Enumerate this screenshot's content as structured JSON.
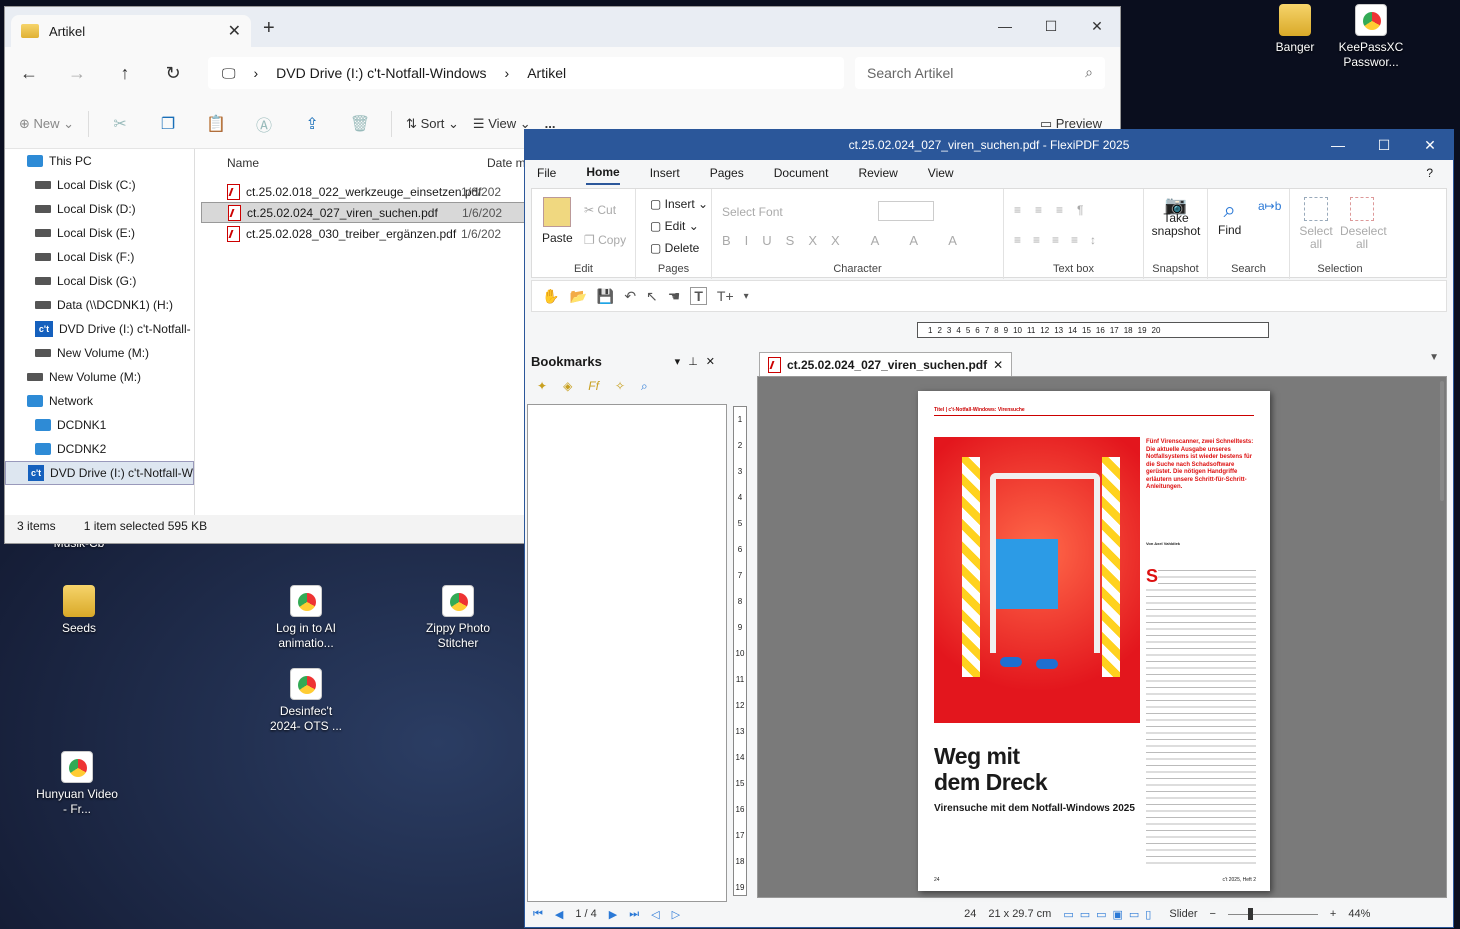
{
  "desktop": {
    "icons": [
      {
        "label": "Banger",
        "type": "folder"
      },
      {
        "label": "KeePassXC Passwor...",
        "type": "chrome"
      },
      {
        "label": "Seeds",
        "type": "folder"
      },
      {
        "label": "Log in to AI animatio...",
        "type": "chrome"
      },
      {
        "label": "Zippy Photo Stitcher",
        "type": "chrome"
      },
      {
        "label": "Desinfec't 2024- OTS ...",
        "type": "chrome"
      },
      {
        "label": "Hunyuan Video - Fr...",
        "type": "chrome"
      },
      {
        "label": "Musik-Cb",
        "type": "text"
      }
    ]
  },
  "explorer": {
    "tab_title": "Artikel",
    "breadcrumb": [
      "DVD Drive (I:) c't-Notfall-Windows",
      "Artikel"
    ],
    "search_placeholder": "Search Artikel",
    "commands": {
      "new": "New",
      "sort": "Sort",
      "view": "View",
      "more": "...",
      "preview": "Preview"
    },
    "nav_items": [
      {
        "label": "This PC",
        "kind": "pc"
      },
      {
        "label": "Local Disk (C:)",
        "kind": "drive"
      },
      {
        "label": "Local Disk (D:)",
        "kind": "drive"
      },
      {
        "label": "Local Disk (E:)",
        "kind": "drive"
      },
      {
        "label": "Local Disk (F:)",
        "kind": "drive"
      },
      {
        "label": "Local Disk (G:)",
        "kind": "drive"
      },
      {
        "label": "Data (\\\\DCDNK1) (H:)",
        "kind": "drive"
      },
      {
        "label": "DVD Drive (I:) c't-Notfall-",
        "kind": "ct"
      },
      {
        "label": "New Volume (M:)",
        "kind": "drive"
      },
      {
        "label": "New Volume (M:)",
        "kind": "drive"
      },
      {
        "label": "Network",
        "kind": "net"
      },
      {
        "label": "DCDNK1",
        "kind": "pc"
      },
      {
        "label": "DCDNK2",
        "kind": "pc"
      },
      {
        "label": "DVD Drive (I:) c't-Notfall-W",
        "kind": "ct"
      }
    ],
    "columns": {
      "name": "Name",
      "date": "Date m"
    },
    "files": [
      {
        "name": "ct.25.02.018_022_werkzeuge_einsetzen.pdf",
        "date": "1/6/202"
      },
      {
        "name": "ct.25.02.024_027_viren_suchen.pdf",
        "date": "1/6/202"
      },
      {
        "name": "ct.25.02.028_030_treiber_ergänzen.pdf",
        "date": "1/6/202"
      }
    ],
    "status": {
      "count": "3 items",
      "selection": "1 item selected  595 KB"
    }
  },
  "pdf": {
    "title": "ct.25.02.024_027_viren_suchen.pdf - FlexiPDF 2025",
    "menu": [
      "File",
      "Home",
      "Insert",
      "Pages",
      "Document",
      "Review",
      "View"
    ],
    "ribbon": {
      "paste": "Paste",
      "cut": "Cut",
      "copy": "Copy",
      "edit_group": "Edit",
      "insert": "Insert",
      "edit": "Edit",
      "delete": "Delete",
      "pages_group": "Pages",
      "font_placeholder": "Select Font",
      "character_group": "Character",
      "textbox_group": "Text box",
      "snapshot": "Take snapshot",
      "snapshot_group": "Snapshot",
      "find": "Find",
      "search_group": "Search",
      "select_all": "Select all",
      "deselect_all": "Deselect all",
      "selection_group": "Selection"
    },
    "ruler_ticks": [
      "1",
      "2",
      "3",
      "4",
      "5",
      "6",
      "7",
      "8",
      "9",
      "10",
      "11",
      "12",
      "13",
      "14",
      "15",
      "16",
      "17",
      "18",
      "19",
      "20"
    ],
    "vruler_ticks": [
      "1",
      "2",
      "3",
      "4",
      "5",
      "6",
      "7",
      "8",
      "9",
      "10",
      "11",
      "12",
      "13",
      "14",
      "15",
      "16",
      "17",
      "18",
      "19"
    ],
    "bookmarks_title": "Bookmarks",
    "doc_tab": "ct.25.02.024_027_viren_suchen.pdf",
    "page_content": {
      "kicker": "Titel | c't-Notfall-Windows: Virensuche",
      "lead": "Fünf Virenscanner, zwei Schnelltests: Die aktuelle Ausgabe unseres Notfallsystems ist wieder bestens für die Suche nach Schadsoftware gerüstet. Die nötigen Handgriffe erläutern unsere Schritt-für-Schritt-Anleitungen.",
      "author": "Von Axel Vahldiek",
      "headline_1": "Weg mit",
      "headline_2": "dem Dreck",
      "subtitle": "Virensuche mit dem Notfall-Windows 2025",
      "page_no": "24",
      "issue": "c't 2025, Heft 2"
    },
    "status": {
      "page": "1 / 4",
      "page_no": "24",
      "size": "21 x 29.7 cm",
      "slider": "Slider",
      "zoom": "44%"
    }
  }
}
